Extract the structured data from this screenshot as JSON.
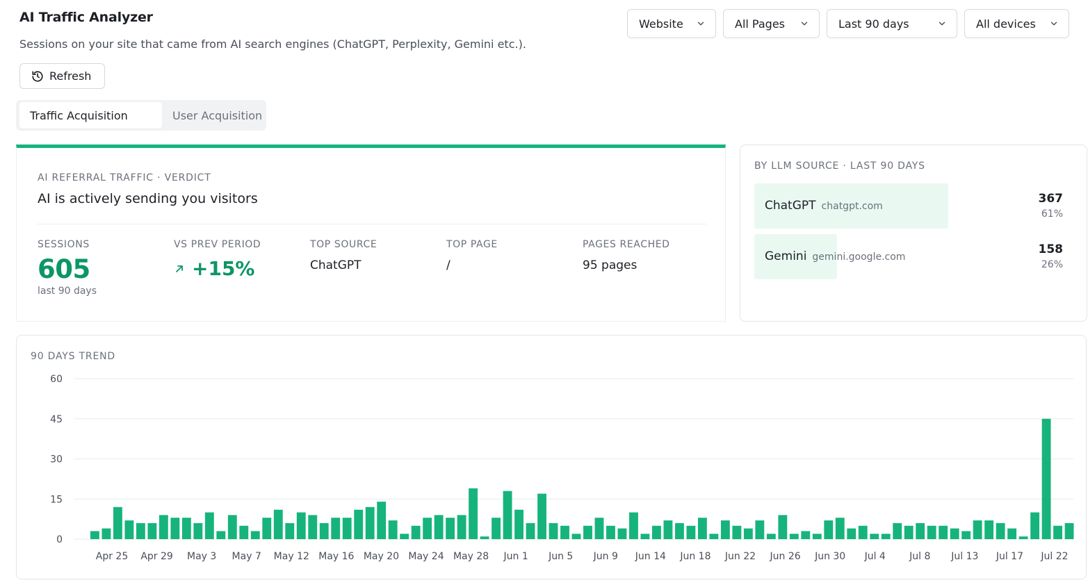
{
  "header": {
    "title": "AI Traffic Analyzer",
    "subtitle": "Sessions on your site that came from AI search engines (ChatGPT, Perplexity, Gemini etc.).",
    "refresh_label": "Refresh"
  },
  "filters": {
    "property": "Website",
    "pages": "All Pages",
    "range": "Last 90 days",
    "devices": "All devices"
  },
  "tabs": [
    {
      "label": "Traffic Acquisition",
      "active": true
    },
    {
      "label": "User Acquisition",
      "active": false
    }
  ],
  "verdict": {
    "label": "AI REFERRAL TRAFFIC · VERDICT",
    "title": "AI is actively sending you visitors",
    "metrics": {
      "sessions_label": "SESSIONS",
      "sessions_value": "605",
      "sessions_sub": "last 90 days",
      "vs_prev_label": "VS PREV PERIOD",
      "vs_prev_value": "+15%",
      "top_source_label": "TOP SOURCE",
      "top_source_value": "ChatGPT",
      "top_page_label": "TOP PAGE",
      "top_page_value": "/",
      "pages_reached_label": "PAGES REACHED",
      "pages_reached_value": "95 pages"
    }
  },
  "llm_sources": {
    "label": "BY LLM SOURCE · LAST 90 DAYS",
    "items": [
      {
        "name": "ChatGPT",
        "domain": "chatgpt.com",
        "count": "367",
        "pct": "61%",
        "share": 0.61
      },
      {
        "name": "Gemini",
        "domain": "gemini.google.com",
        "count": "158",
        "pct": "26%",
        "share": 0.26
      }
    ]
  },
  "colors": {
    "accent": "#16b47c",
    "accent_dark": "#0d9665",
    "bar_fill": "#e9f9f2",
    "grid": "#e8eaed"
  },
  "icons": {
    "refresh": "history-icon",
    "dropdown": "chevron-down-icon",
    "delta": "arrow-up-right-icon"
  },
  "chart_data": {
    "type": "bar",
    "title": "90 DAYS TREND",
    "ylim": [
      0,
      60
    ],
    "yticks": [
      0,
      15,
      30,
      45,
      60
    ],
    "grid": true,
    "x_tick_labels": [
      "Apr 25",
      "Apr 29",
      "May 3",
      "May 7",
      "May 12",
      "May 16",
      "May 20",
      "May 24",
      "May 28",
      "Jun 1",
      "Jun 5",
      "Jun 9",
      "Jun 14",
      "Jun 18",
      "Jun 22",
      "Jun 26",
      "Jun 30",
      "Jul 4",
      "Jul 8",
      "Jul 13",
      "Jul 17",
      "Jul 22"
    ],
    "values": [
      3,
      4,
      12,
      7,
      6,
      6,
      9,
      8,
      8,
      6,
      10,
      3,
      9,
      5,
      3,
      8,
      11,
      6,
      10,
      9,
      6,
      8,
      8,
      11,
      12,
      14,
      7,
      2,
      5,
      8,
      9,
      8,
      9,
      19,
      1,
      8,
      18,
      11,
      6,
      17,
      6,
      5,
      2,
      5,
      8,
      5,
      4,
      10,
      2,
      5,
      7,
      6,
      5,
      8,
      2,
      7,
      5,
      4,
      7,
      2,
      9,
      2,
      3,
      2,
      7,
      8,
      4,
      5,
      2,
      2,
      6,
      5,
      6,
      5,
      5,
      4,
      3,
      7,
      7,
      6,
      4,
      1,
      10,
      45,
      5,
      6
    ]
  }
}
